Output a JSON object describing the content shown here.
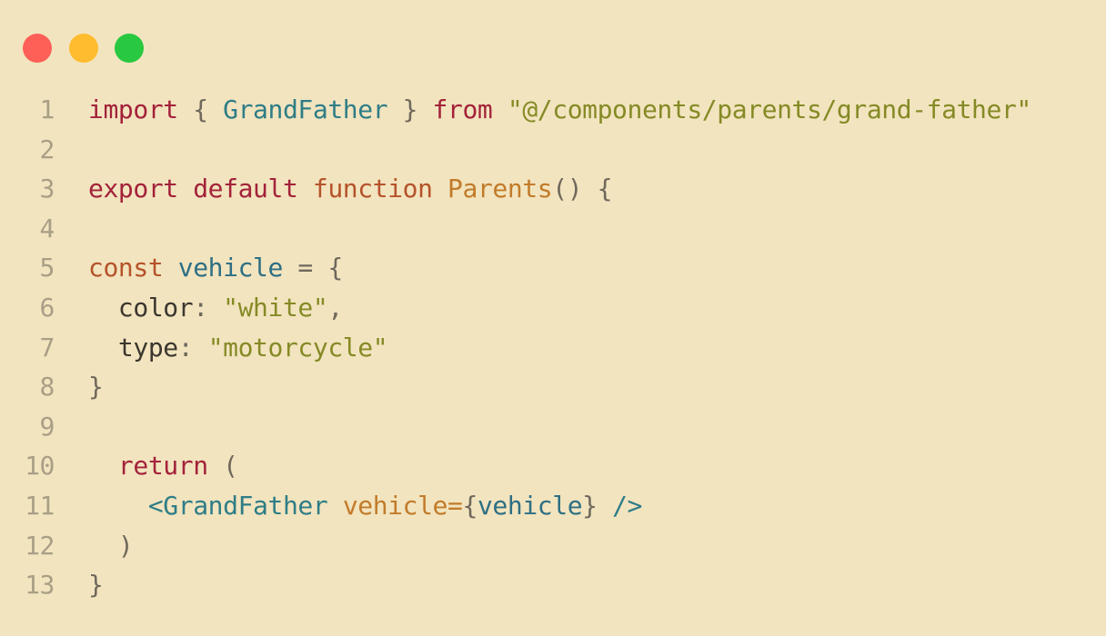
{
  "window": {
    "controls": [
      {
        "name": "close-dot",
        "color": "#fe5f57"
      },
      {
        "name": "minimize-dot",
        "color": "#febc2e"
      },
      {
        "name": "zoom-dot",
        "color": "#28c840"
      }
    ]
  },
  "code": {
    "lines": [
      {
        "n": "1",
        "tokens": [
          {
            "t": "import",
            "c": "keyword"
          },
          {
            "t": " { ",
            "c": "punct"
          },
          {
            "t": "GrandFather",
            "c": "class"
          },
          {
            "t": " } ",
            "c": "punct"
          },
          {
            "t": "from",
            "c": "keyword"
          },
          {
            "t": " ",
            "c": "punct"
          },
          {
            "t": "\"@/components/parents/grand-father\"",
            "c": "string"
          }
        ]
      },
      {
        "n": "2",
        "tokens": []
      },
      {
        "n": "3",
        "tokens": [
          {
            "t": "export",
            "c": "keyword"
          },
          {
            "t": " ",
            "c": "punct"
          },
          {
            "t": "default",
            "c": "keyword"
          },
          {
            "t": " ",
            "c": "punct"
          },
          {
            "t": "function",
            "c": "keyword2"
          },
          {
            "t": " ",
            "c": "punct"
          },
          {
            "t": "Parents",
            "c": "fn"
          },
          {
            "t": "() {",
            "c": "punct"
          }
        ]
      },
      {
        "n": "4",
        "tokens": []
      },
      {
        "n": "5",
        "tokens": [
          {
            "t": "const",
            "c": "keyword2"
          },
          {
            "t": " ",
            "c": "punct"
          },
          {
            "t": "vehicle",
            "c": "ident"
          },
          {
            "t": " = {",
            "c": "punct"
          }
        ]
      },
      {
        "n": "6",
        "tokens": [
          {
            "t": "  ",
            "c": "punct"
          },
          {
            "t": "color",
            "c": "prop"
          },
          {
            "t": ": ",
            "c": "punct"
          },
          {
            "t": "\"white\"",
            "c": "string"
          },
          {
            "t": ",",
            "c": "punct"
          }
        ]
      },
      {
        "n": "7",
        "tokens": [
          {
            "t": "  ",
            "c": "punct"
          },
          {
            "t": "type",
            "c": "prop"
          },
          {
            "t": ": ",
            "c": "punct"
          },
          {
            "t": "\"motorcycle\"",
            "c": "string"
          }
        ]
      },
      {
        "n": "8",
        "tokens": [
          {
            "t": "}",
            "c": "punct"
          }
        ]
      },
      {
        "n": "9",
        "tokens": []
      },
      {
        "n": "10",
        "tokens": [
          {
            "t": "  ",
            "c": "punct"
          },
          {
            "t": "return",
            "c": "keyword"
          },
          {
            "t": " (",
            "c": "punct"
          }
        ]
      },
      {
        "n": "11",
        "tokens": [
          {
            "t": "    ",
            "c": "punct"
          },
          {
            "t": "<GrandFather",
            "c": "tag"
          },
          {
            "t": " ",
            "c": "punct"
          },
          {
            "t": "vehicle",
            "c": "attr"
          },
          {
            "t": "=",
            "c": "attr"
          },
          {
            "t": "{",
            "c": "punct"
          },
          {
            "t": "vehicle",
            "c": "ident"
          },
          {
            "t": "}",
            "c": "punct"
          },
          {
            "t": " ",
            "c": "punct"
          },
          {
            "t": "/>",
            "c": "tag"
          }
        ]
      },
      {
        "n": "12",
        "tokens": [
          {
            "t": "  )",
            "c": "punct"
          }
        ]
      },
      {
        "n": "13",
        "tokens": [
          {
            "t": "}",
            "c": "punct"
          }
        ]
      }
    ]
  }
}
